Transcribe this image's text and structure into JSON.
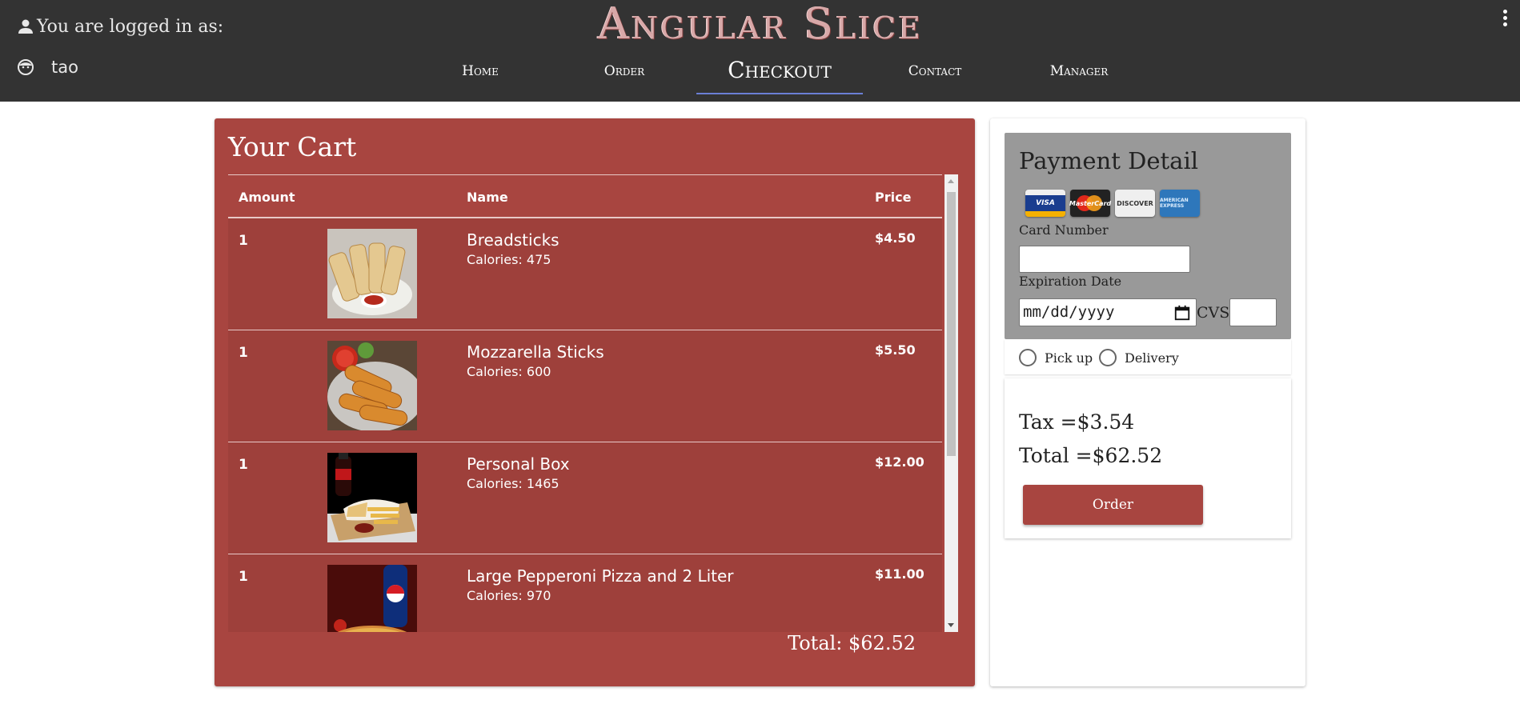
{
  "header": {
    "logged_in_label": "You are logged in as:",
    "username": "tao",
    "brand": "Angular Slice",
    "nav": [
      {
        "label": "Home",
        "active": false
      },
      {
        "label": "Order",
        "active": false
      },
      {
        "label": "Checkout",
        "active": true
      },
      {
        "label": "Contact",
        "active": false
      },
      {
        "label": "Manager",
        "active": false
      }
    ]
  },
  "cart": {
    "title": "Your Cart",
    "columns": {
      "amount": "Amount",
      "name": "Name",
      "price": "Price"
    },
    "items": [
      {
        "amount": "1",
        "name": "Breadsticks",
        "calories": "Calories: 475",
        "price": "$4.50",
        "image": "breadsticks-image"
      },
      {
        "amount": "1",
        "name": "Mozzarella Sticks",
        "calories": "Calories: 600",
        "price": "$5.50",
        "image": "mozzarella-sticks-image"
      },
      {
        "amount": "1",
        "name": "Personal Box",
        "calories": "Calories: 1465",
        "price": "$12.00",
        "image": "personal-box-image"
      },
      {
        "amount": "1",
        "name": "Large Pepperoni Pizza and 2 Liter",
        "calories": "Calories: 970",
        "price": "$11.00",
        "image": "pepperoni-pizza-image"
      }
    ],
    "total": "Total: $62.52"
  },
  "payment": {
    "title": "Payment Detail",
    "cards": [
      "VISA",
      "MasterCard",
      "DISCOVER",
      "AMERICAN EXPRESS"
    ],
    "card_number_label": "Card Number",
    "card_number_value": "",
    "expiration_label": "Expiration Date",
    "expiration_placeholder": "mm/dd/yyyy",
    "cvs_label": "CVS",
    "cvs_value": ""
  },
  "delivery": {
    "pickup_label": "Pick up",
    "delivery_label": "Delivery"
  },
  "summary": {
    "tax": "Tax =$3.54",
    "total": "Total =$62.52",
    "order_button": "Order"
  },
  "colors": {
    "header_bg": "#333333",
    "cart_bg": "#a84540",
    "payment_bg": "#999999",
    "accent": "#6b7fd6"
  }
}
